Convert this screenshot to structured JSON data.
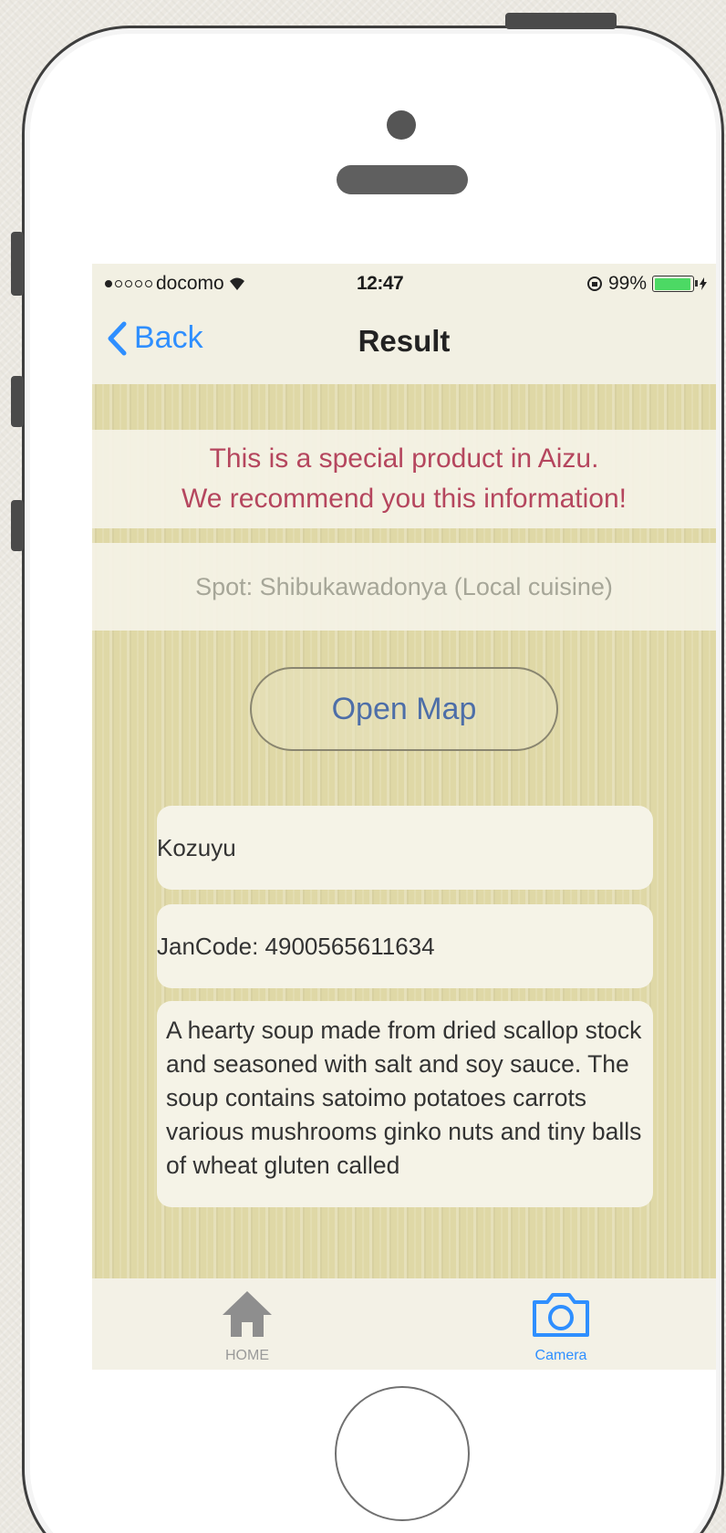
{
  "status_bar": {
    "carrier": "docomo",
    "time": "12:47",
    "battery": "99%"
  },
  "navbar": {
    "back_label": "Back",
    "title": "Result"
  },
  "banner": {
    "line1": "This is a special product in Aizu.",
    "line2": "We recommend you this information!"
  },
  "spot": {
    "text": "Spot: Shibukawadonya (Local cuisine)"
  },
  "open_map": {
    "label": "Open Map"
  },
  "product": {
    "name": "Kozuyu",
    "jan_code": "JanCode: 4900565611634",
    "description": "A hearty soup made from dried scallop stock and seasoned with salt and soy sauce. The soup contains satoimo potatoes carrots various mushrooms ginko nuts and tiny balls of wheat gluten called"
  },
  "tabbar": {
    "home_label": "HOME",
    "camera_label": "Camera"
  },
  "colors": {
    "accent": "#2f8fff",
    "banner_text": "#b5465e",
    "battery": "#4cd964"
  }
}
